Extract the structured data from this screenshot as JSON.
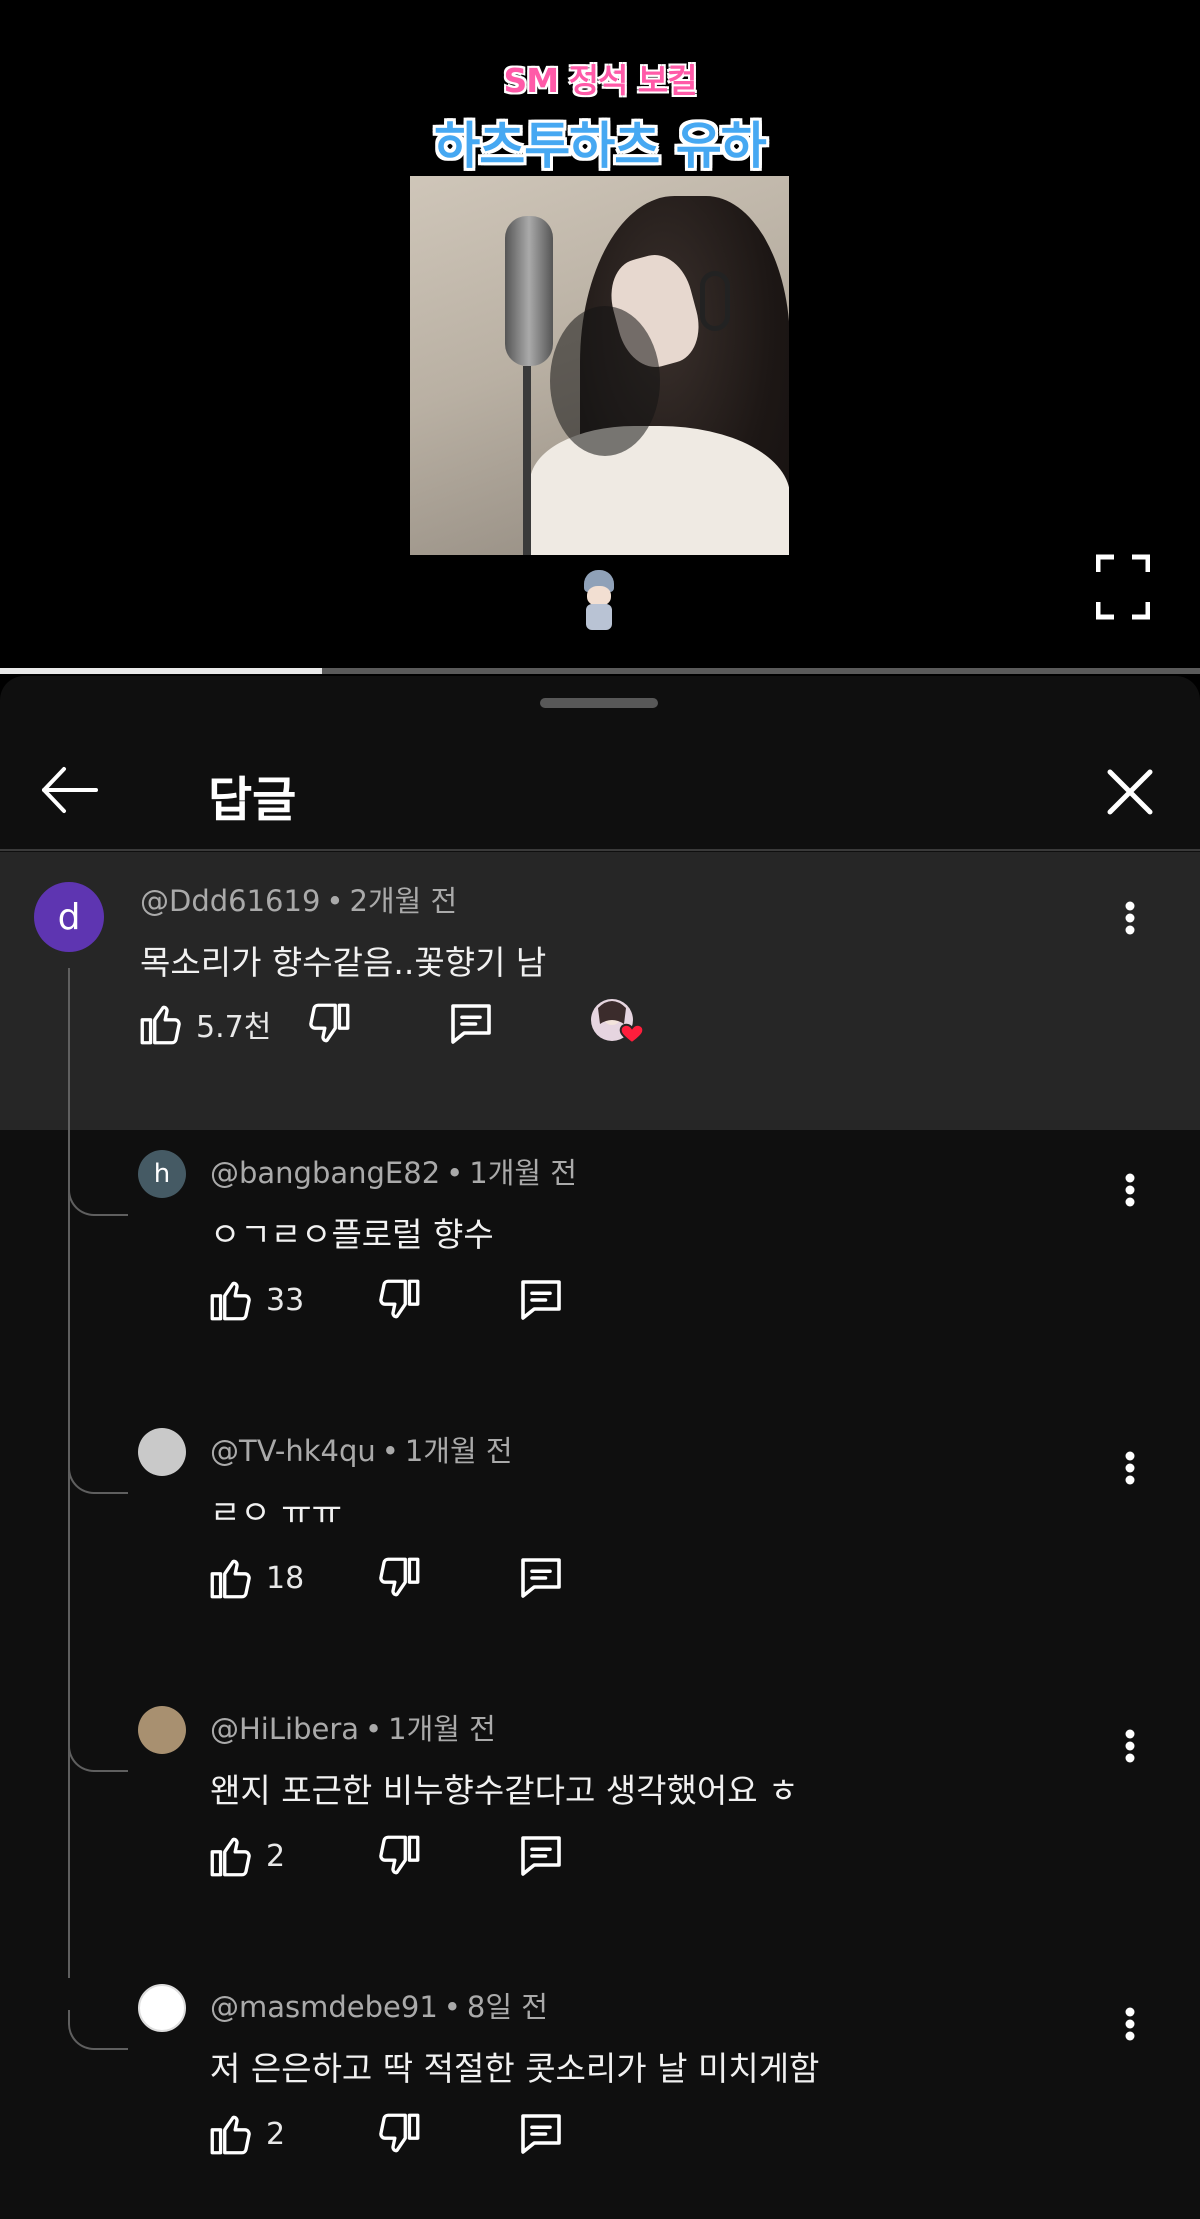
{
  "video": {
    "caption_top": "SM 정석 보컬",
    "caption_bottom": "하츠투하츠 유하",
    "progress_fraction": 0.268
  },
  "sheet": {
    "title": "답글"
  },
  "parent_comment": {
    "avatar_letter": "d",
    "avatar_color": "#5e35b1",
    "handle": "@Ddd61619",
    "time": "2개월 전",
    "text": "목소리가 향수같음..꽃향기 남",
    "likes": "5.7천"
  },
  "replies": [
    {
      "avatar_letter": "h",
      "avatar_color": "#455a64",
      "handle": "@bangbangE82",
      "time": "1개월 전",
      "text": "ㅇㄱㄹㅇ플로럴 향수",
      "likes": "33"
    },
    {
      "avatar_letter": "",
      "avatar_color": "#c9c9c9",
      "handle": "@TV-hk4qu",
      "time": "1개월 전",
      "text": "ㄹㅇ ㅠㅠ",
      "likes": "18"
    },
    {
      "avatar_letter": "",
      "avatar_color": "#a89070",
      "handle": "@HiLibera",
      "time": "1개월 전",
      "text": "왠지 포근한 비누향수같다고 생각했어요 ㅎ",
      "likes": "2"
    },
    {
      "avatar_letter": "",
      "avatar_color": "#ffffff",
      "handle": "@masmdebe91",
      "time": "8일 전",
      "text": "저 은은하고 딱 적절한 콧소리가 날 미치게함",
      "likes": "2"
    }
  ],
  "icons": {
    "back": "arrow-left-icon",
    "close": "close-icon",
    "like": "thumbs-up-icon",
    "dislike": "thumbs-down-icon",
    "reply": "reply-icon",
    "more": "more-vert-icon",
    "fullscreen": "fullscreen-icon"
  },
  "colors": {
    "sheet_bg": "#0f0f0f",
    "highlight_bg": "#262626",
    "heart": "#ff1e3c"
  }
}
